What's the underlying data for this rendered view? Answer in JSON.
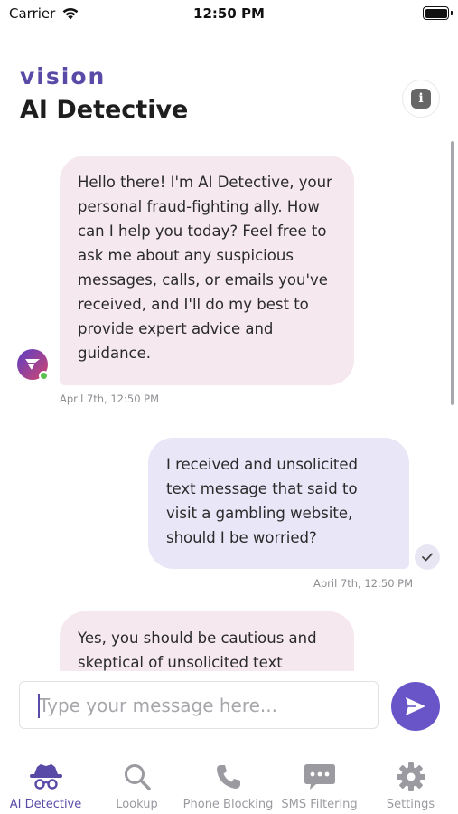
{
  "status_bar": {
    "carrier": "Carrier",
    "time": "12:50 PM"
  },
  "header": {
    "brand": "vision",
    "title": "AI Detective",
    "info_icon": "info-icon"
  },
  "messages": [
    {
      "sender": "ai",
      "text": "Hello there! I'm AI Detective, your personal fraud-fighting ally. How can I help you today? Feel free to ask me about any suspicious messages, calls, or emails you've received, and I'll do my best to provide expert advice and guidance.",
      "time": "April 7th, 12:50 PM"
    },
    {
      "sender": "user",
      "text": "I received and unsolicited text message that said to visit a gambling website, should I be worried?",
      "time": "April 7th, 12:50 PM"
    },
    {
      "sender": "ai",
      "text": "Yes, you should be cautious and skeptical of unsolicited text"
    }
  ],
  "composer": {
    "placeholder": "Type your message here..."
  },
  "tabs": [
    {
      "label": "AI Detective",
      "icon": "detective-icon",
      "active": true
    },
    {
      "label": "Lookup",
      "icon": "search-icon",
      "active": false
    },
    {
      "label": "Phone Blocking",
      "icon": "phone-icon",
      "active": false
    },
    {
      "label": "SMS Filtering",
      "icon": "chat-bubble-icon",
      "active": false
    },
    {
      "label": "Settings",
      "icon": "gear-icon",
      "active": false
    }
  ],
  "colors": {
    "accent": "#5a4aa8",
    "send_button": "#6a55c8",
    "ai_bubble": "#f5e8ef",
    "user_bubble": "#e8e6f7",
    "online": "#5cc24f"
  }
}
